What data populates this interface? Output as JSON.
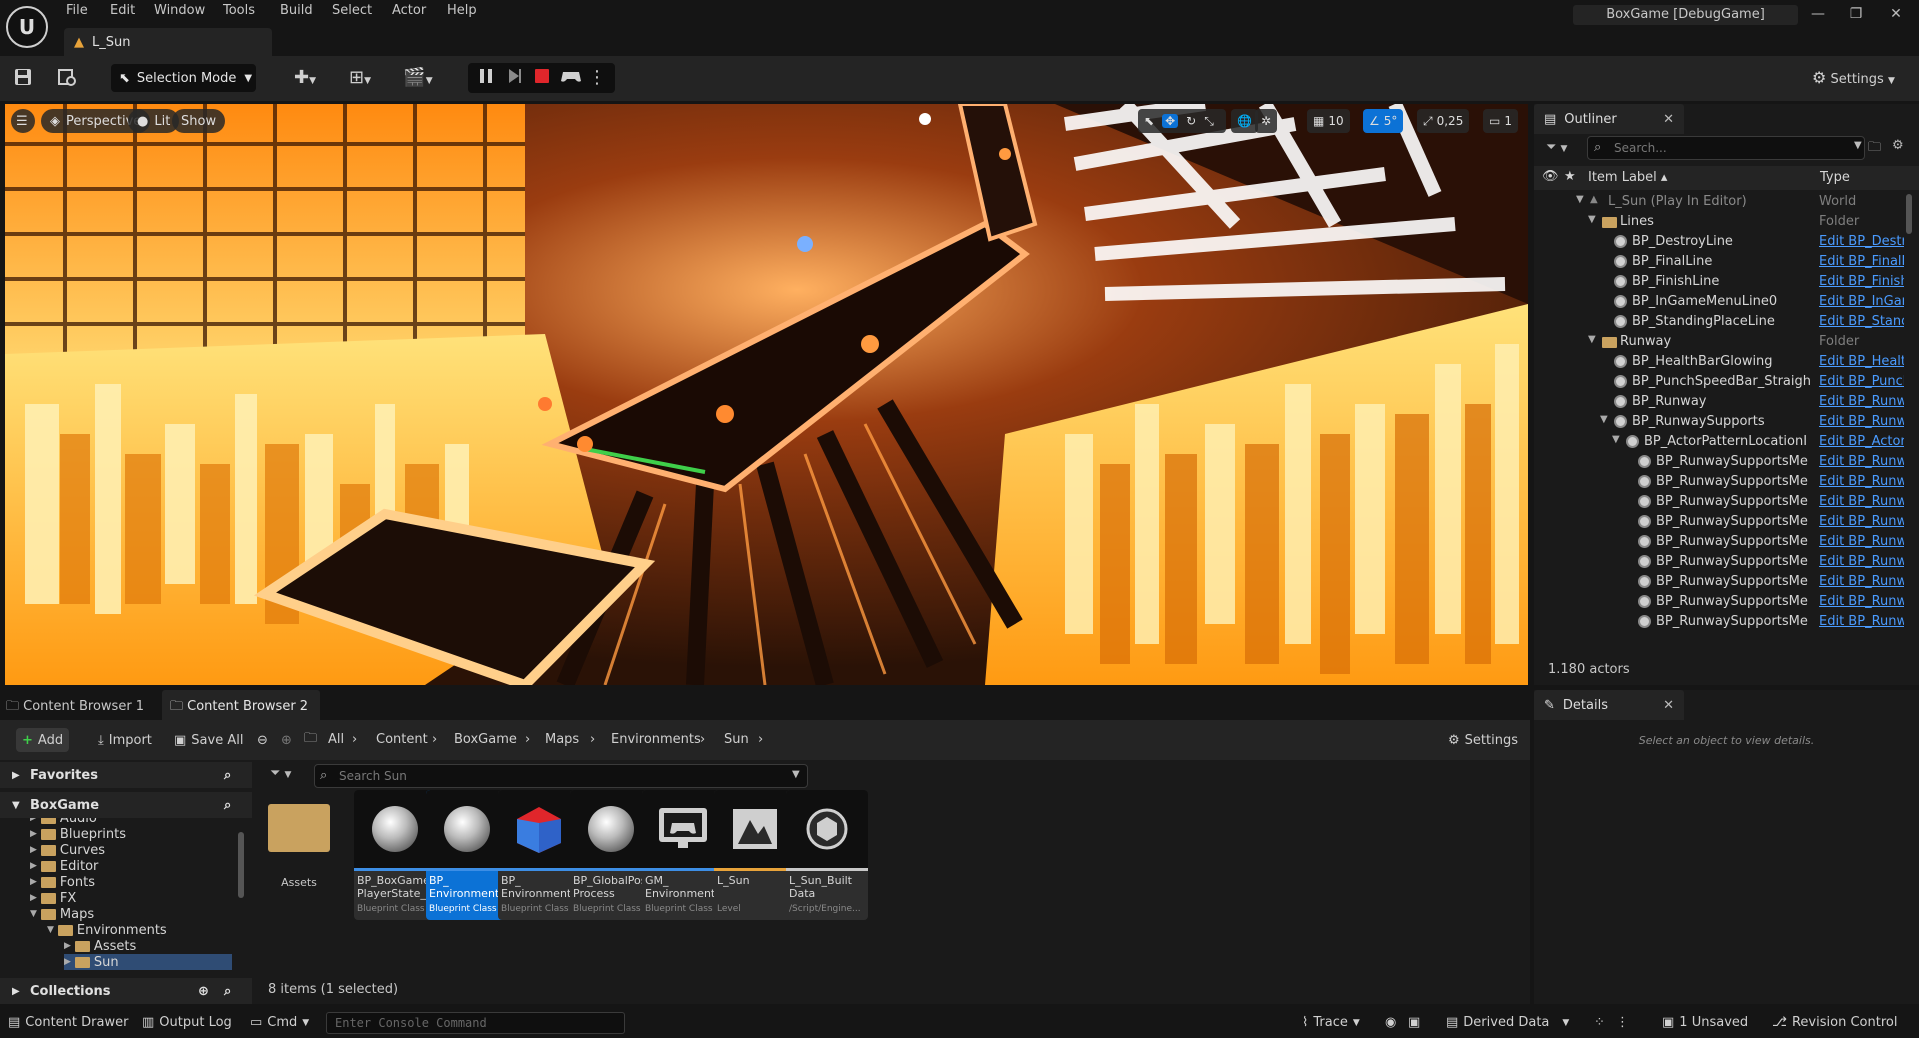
{
  "menu": [
    "File",
    "Edit",
    "Window",
    "Tools",
    "Build",
    "Select",
    "Actor",
    "Help"
  ],
  "document_tab": "L_Sun",
  "project_name": "BoxGame [DebugGame]",
  "toolbar": {
    "selection_mode": "Selection Mode",
    "settings": "Settings"
  },
  "viewport": {
    "perspective": "Perspective",
    "lit": "Lit",
    "show": "Show",
    "grid_snap": "10",
    "rotation_snap": "5°",
    "scale_snap": "0,25",
    "camera_speed": "1"
  },
  "outliner": {
    "title": "Outliner",
    "search_placeholder": "Search...",
    "col_label": "Item Label",
    "col_type": "Type",
    "rows": [
      {
        "name": "L_Sun (Play In Editor)",
        "type": "World",
        "kind": "world",
        "depth": 0,
        "expanded": true
      },
      {
        "name": "Lines",
        "type": "Folder",
        "kind": "folder",
        "depth": 1,
        "expanded": true
      },
      {
        "name": "BP_DestroyLine",
        "type": "Edit BP_Destro",
        "kind": "actor",
        "depth": 2
      },
      {
        "name": "BP_FinalLine",
        "type": "Edit BP_FinalL",
        "kind": "actor",
        "depth": 2
      },
      {
        "name": "BP_FinishLine",
        "type": "Edit BP_Finish",
        "kind": "actor",
        "depth": 2
      },
      {
        "name": "BP_InGameMenuLine0",
        "type": "Edit BP_InGam",
        "kind": "actor",
        "depth": 2
      },
      {
        "name": "BP_StandingPlaceLine",
        "type": "Edit BP_Stand",
        "kind": "actor",
        "depth": 2
      },
      {
        "name": "Runway",
        "type": "Folder",
        "kind": "folder",
        "depth": 1,
        "expanded": true
      },
      {
        "name": "BP_HealthBarGlowing",
        "type": "Edit BP_Healtl",
        "kind": "actor",
        "depth": 2
      },
      {
        "name": "BP_PunchSpeedBar_Straigh",
        "type": "Edit BP_Punch",
        "kind": "actor",
        "depth": 2
      },
      {
        "name": "BP_Runway",
        "type": "Edit BP_Runwa",
        "kind": "actor",
        "depth": 2
      },
      {
        "name": "BP_RunwaySupports",
        "type": "Edit BP_Runwa",
        "kind": "actor",
        "depth": 2,
        "expanded": true
      },
      {
        "name": "BP_ActorPatternLocationI",
        "type": "Edit BP_ActorI",
        "kind": "actor",
        "depth": 3,
        "expanded": true
      },
      {
        "name": "BP_RunwaySupportsMe",
        "type": "Edit BP_Runwa",
        "kind": "actor",
        "depth": 4
      },
      {
        "name": "BP_RunwaySupportsMe",
        "type": "Edit BP_Runwa",
        "kind": "actor",
        "depth": 4
      },
      {
        "name": "BP_RunwaySupportsMe",
        "type": "Edit BP_Runwa",
        "kind": "actor",
        "depth": 4
      },
      {
        "name": "BP_RunwaySupportsMe",
        "type": "Edit BP_Runwa",
        "kind": "actor",
        "depth": 4
      },
      {
        "name": "BP_RunwaySupportsMe",
        "type": "Edit BP_Runwa",
        "kind": "actor",
        "depth": 4
      },
      {
        "name": "BP_RunwaySupportsMe",
        "type": "Edit BP_Runwa",
        "kind": "actor",
        "depth": 4
      },
      {
        "name": "BP_RunwaySupportsMe",
        "type": "Edit BP_Runwa",
        "kind": "actor",
        "depth": 4
      },
      {
        "name": "BP_RunwaySupportsMe",
        "type": "Edit BP_Runwa",
        "kind": "actor",
        "depth": 4
      },
      {
        "name": "BP_RunwaySupportsMe",
        "type": "Edit BP_Runwa",
        "kind": "actor",
        "depth": 4
      },
      {
        "name": "BP_RunwaySupportsMe",
        "type": "Edit BP_Runwa",
        "kind": "actor",
        "depth": 4
      }
    ],
    "actors_count": "1.180 actors"
  },
  "details": {
    "title": "Details",
    "empty": "Select an object to view details."
  },
  "content_browser": {
    "tab1": "Content Browser 1",
    "tab2": "Content Browser 2",
    "add": "Add",
    "import": "Import",
    "save_all": "Save All",
    "settings": "Settings",
    "breadcrumb": [
      "All",
      "Content",
      "BoxGame",
      "Maps",
      "Environments",
      "Sun"
    ],
    "favorites": "Favorites",
    "root": "BoxGame",
    "collections": "Collections",
    "tree": [
      {
        "name": "Audio",
        "depth": 1
      },
      {
        "name": "Blueprints",
        "depth": 1
      },
      {
        "name": "Curves",
        "depth": 1
      },
      {
        "name": "Editor",
        "depth": 1
      },
      {
        "name": "Fonts",
        "depth": 1
      },
      {
        "name": "FX",
        "depth": 1
      },
      {
        "name": "Maps",
        "depth": 1,
        "open": true
      },
      {
        "name": "Environments",
        "depth": 2,
        "open": true
      },
      {
        "name": "Assets",
        "depth": 3
      },
      {
        "name": "Sun",
        "depth": 3,
        "selected": true
      }
    ],
    "search_placeholder": "Search Sun",
    "assets": [
      {
        "name": "Assets",
        "cls": "",
        "kind": "folder"
      },
      {
        "name": "BP_BoxGame PlayerState_",
        "cls": "Blueprint Class",
        "kind": "sphere",
        "color": "#3d8ee5"
      },
      {
        "name": "BP_ Environment",
        "cls": "Blueprint Class",
        "kind": "sphere",
        "color": "#3d8ee5",
        "selected": true
      },
      {
        "name": "BP_ Environment",
        "cls": "Blueprint Class",
        "kind": "cube",
        "color": "#3d8ee5"
      },
      {
        "name": "BP_GlobalPost Process",
        "cls": "Blueprint Class",
        "kind": "sphere",
        "color": "#3d8ee5"
      },
      {
        "name": "GM_ Environment",
        "cls": "Blueprint Class",
        "kind": "gamemode",
        "color": "#3d8ee5"
      },
      {
        "name": "L_Sun",
        "cls": "Level",
        "kind": "level",
        "color": "#e8a33a"
      },
      {
        "name": "L_Sun_Built Data",
        "cls": "/Script/Engine...",
        "kind": "builtdata",
        "color": "#c8c8c8"
      }
    ],
    "items_count": "8 items (1 selected)"
  },
  "statusbar": {
    "content_drawer": "Content Drawer",
    "output_log": "Output Log",
    "cmd": "Cmd",
    "console_placeholder": "Enter Console Command",
    "trace": "Trace",
    "derived_data": "Derived Data",
    "unsaved": "1 Unsaved",
    "revision_control": "Revision Control"
  },
  "colors": {
    "accent": "#0c72d6",
    "link": "#4a9bff",
    "panel": "#1a1a1a",
    "record": "#e0262b"
  }
}
